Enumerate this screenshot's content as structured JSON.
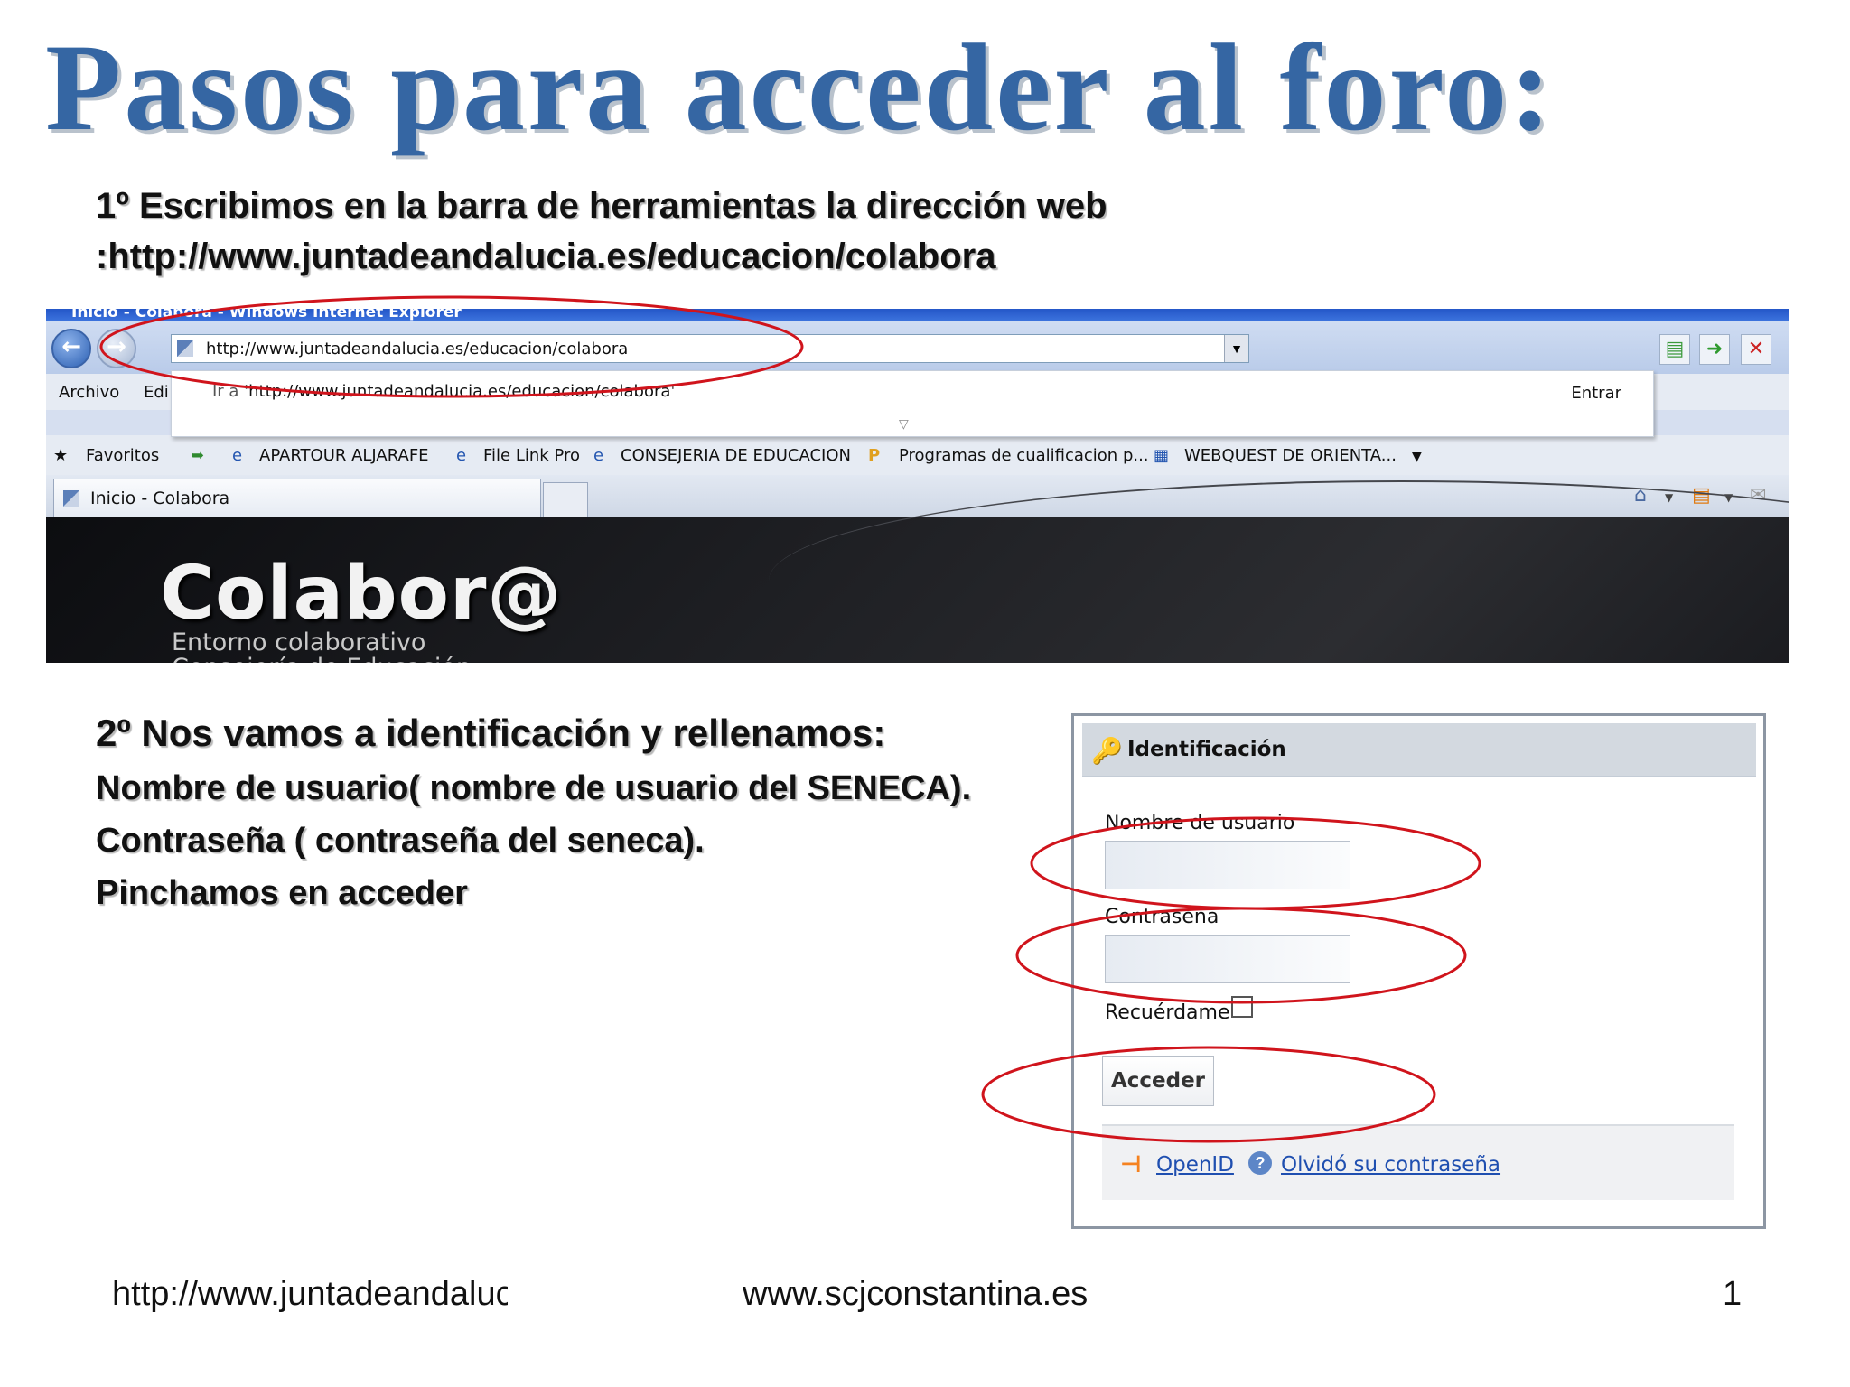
{
  "title": "Pasos para acceder al foro:",
  "step1": {
    "line1": "1º Escribimos en la barra de herramientas la dirección web",
    "line2": ":http://www.juntadeandalucia.es/educacion/colabora"
  },
  "browser": {
    "window_title": "Inicio - Colabora - Windows Internet Explorer",
    "address_url": "http://www.juntadeandalucia.es/educacion/colabora",
    "menu": [
      "Archivo",
      "Edi"
    ],
    "dropdown_goto_prefix": "Ir a '",
    "dropdown_goto_url": "http://www.juntadeandalucia.es/educacion/colabora",
    "dropdown_goto_suffix": "'",
    "dropdown_enter": "Entrar",
    "favorites_label": "Favoritos",
    "favorites": [
      "APARTOUR ALJARAFE",
      "File Link Pro",
      "CONSEJERIA DE EDUCACION",
      "Programas de cualificacion p...",
      "WEBQUEST DE ORIENTA..."
    ],
    "tab_label": "Inicio - Colabora",
    "brand": "Colabor@",
    "tagline1": "Entorno colaborativo",
    "tagline2": "Consejería de Educación"
  },
  "step2": {
    "heading": "2º Nos vamos a identificación y rellenamos:",
    "line1": "Nombre de usuario( nombre de usuario del SENECA).",
    "line2": "Contraseña ( contraseña del seneca).",
    "line3": "Pinchamos en acceder"
  },
  "login": {
    "header": "Identificación",
    "username_label": "Nombre de usuario",
    "password_label": "Contraseña",
    "remember_label": "Recuérdame",
    "submit_label": "Acceder",
    "openid_label": "OpenID",
    "forgot_label": "Olvidó su contraseña"
  },
  "footer": {
    "left": "http://www.juntadeandalucia.es/educacion/colabora",
    "center": "www.scjconstantina.es",
    "page_number": "1"
  },
  "colors": {
    "title": "#3566a3",
    "annotation_ellipse": "#d0141c",
    "link": "#1f4fb0"
  }
}
